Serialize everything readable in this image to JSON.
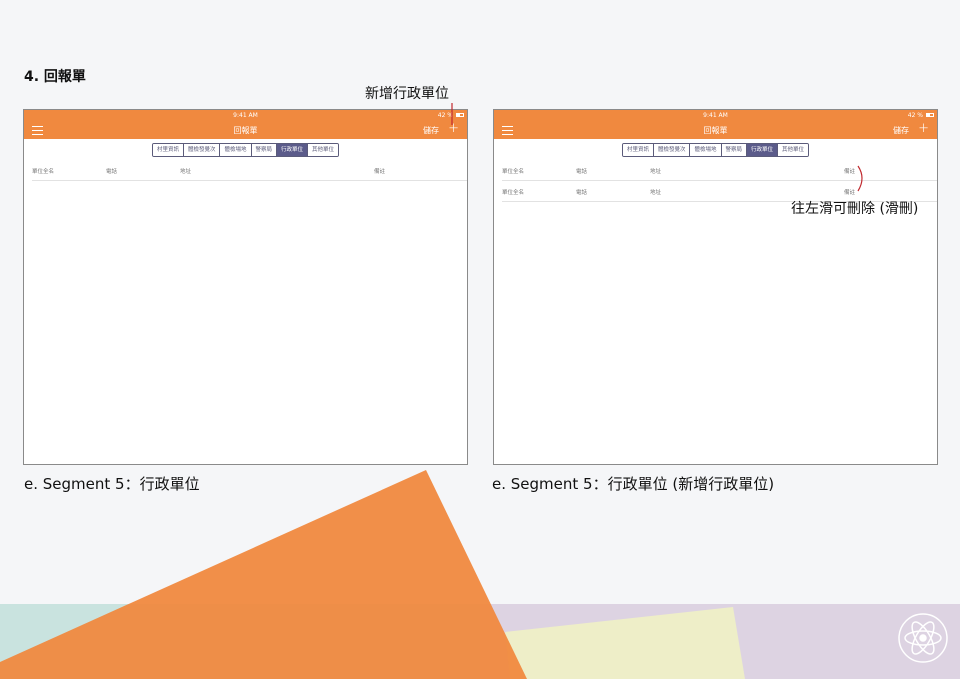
{
  "page": {
    "section_title": "4. 回報單",
    "captions": {
      "left": "e. Segment  5：行政單位",
      "right": "e. Segment  5：行政單位 (新增行政單位)"
    },
    "annotations": {
      "add_unit": "新增行政單位",
      "swipe_delete": "往左滑可刪除 (滑刪)"
    },
    "colors": {
      "accent": "#f0893f",
      "segment_active": "#5b5b8a",
      "deco_teal": "#c9e3df",
      "deco_lilac": "#ddd3e2",
      "deco_yellow": "#eeeec8"
    }
  },
  "screens": [
    {
      "status": {
        "time": "9:41 AM",
        "battery": "42 %"
      },
      "nav": {
        "title": "回報單",
        "save": "儲存",
        "add": "+"
      },
      "segments": [
        "村里資訊",
        "體檢發覺次",
        "體檢場地",
        "警察局",
        "行政單位",
        "其他單位"
      ],
      "active_segment": 4,
      "table_header": [
        "單位全名",
        "電話",
        "地址",
        "備註"
      ],
      "rows": []
    },
    {
      "status": {
        "time": "9:41 AM",
        "battery": "42 %"
      },
      "nav": {
        "title": "回報單",
        "save": "儲存",
        "add": "+"
      },
      "segments": [
        "村里資訊",
        "體檢發覺次",
        "體檢場地",
        "警察局",
        "行政單位",
        "其他單位"
      ],
      "active_segment": 4,
      "table_header": [
        "單位全名",
        "電話",
        "地址",
        "備註"
      ],
      "rows": [
        [
          "單位全名",
          "電話",
          "地址",
          "備註"
        ]
      ]
    }
  ]
}
